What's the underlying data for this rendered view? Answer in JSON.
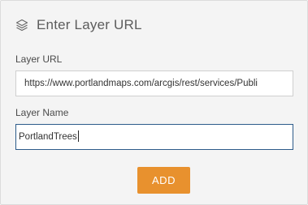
{
  "header": {
    "icon": "layers-icon",
    "title": "Enter Layer URL"
  },
  "layer_url": {
    "label": "Layer URL",
    "value": "https://www.portlandmaps.com/arcgis/rest/services/Publi"
  },
  "layer_name": {
    "label": "Layer Name",
    "value": "PortlandTrees"
  },
  "add_button": {
    "label": "ADD",
    "color": "#e8912e"
  },
  "colors": {
    "panel_background": "#f4f4f4",
    "focus_border": "#2d5b8a"
  }
}
